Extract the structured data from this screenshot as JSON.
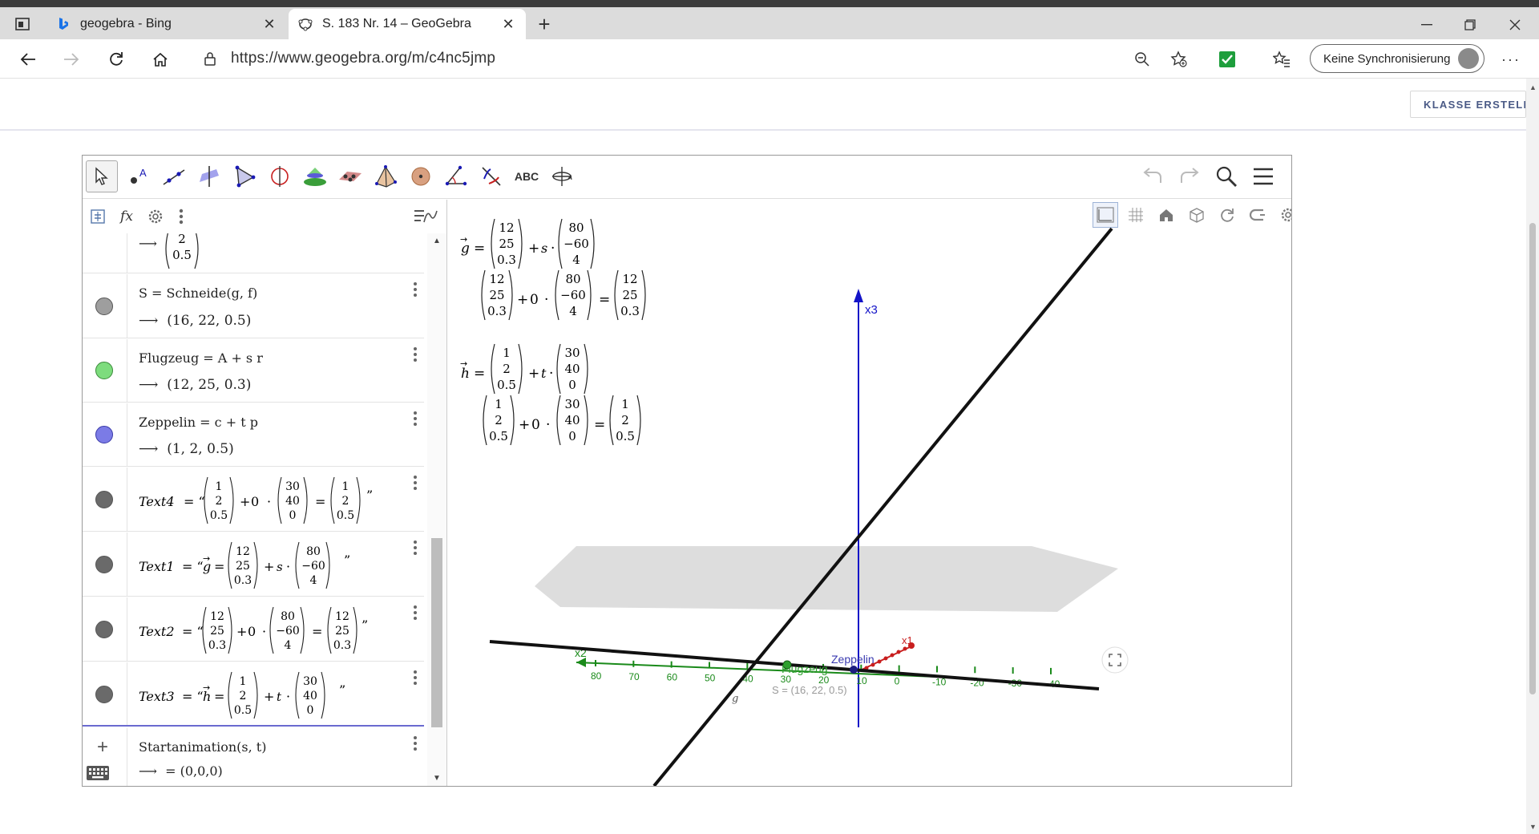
{
  "browser": {
    "tabs": [
      {
        "title": "geogebra - Bing",
        "active": false
      },
      {
        "title": "S. 183 Nr. 14 – GeoGebra",
        "active": true
      }
    ],
    "url": "https://www.geogebra.org/m/c4nc5jmp",
    "sync_label": "Keine Synchronisierung",
    "colors": {
      "accent_green": "#1e9e3c"
    }
  },
  "page": {
    "class_button": "KLASSE ERSTELLE"
  },
  "applet": {
    "toolbar": {
      "tools": [
        "move-tool",
        "point-tool",
        "line-tool",
        "perpendicular-tool",
        "polygon-tool",
        "circle-tool",
        "intersect-surfaces-tool",
        "plane-tool",
        "pyramid-tool",
        "sphere-tool",
        "angle-tool",
        "reflect-tool",
        "text-tool",
        "rotate-view-tool"
      ],
      "text_tool_label": "ABC"
    },
    "algebra": {
      "top_value": [
        "2",
        "0.5"
      ],
      "rows": [
        {
          "def_lhs": "S",
          "def_rhs": "Schneide(g, f)",
          "value": "(16, 22, 0.5)",
          "marble_color": "#9e9e9e"
        },
        {
          "def_lhs": "Flugzeug",
          "def_rhs": "A + s r",
          "value": "(12, 25, 0.3)",
          "marble_color": "#7ddc7d"
        },
        {
          "def_lhs": "Zeppelin",
          "def_rhs": "c + t p",
          "value": "(1, 2, 0.5)",
          "marble_color": "#7b7be6"
        },
        {
          "def_lhs": "Text4",
          "marble_color": "#6a6a6a"
        },
        {
          "def_lhs": "Text1",
          "marble_color": "#6a6a6a"
        },
        {
          "def_lhs": "Text2",
          "marble_color": "#6a6a6a"
        },
        {
          "def_lhs": "Text3",
          "marble_color": "#6a6a6a"
        }
      ],
      "input_row": {
        "def": "Startanimation(s, t)",
        "value": "= (0,0,0)"
      }
    },
    "view3d": {
      "eq_g": {
        "name": "g",
        "p": [
          "12",
          "25",
          "0.3"
        ],
        "param": "s",
        "d": [
          "80",
          "−60",
          "4"
        ]
      },
      "eq_h": {
        "name": "h",
        "p": [
          "1",
          "2",
          "0.5"
        ],
        "param": "t",
        "d": [
          "30",
          "40",
          "0"
        ]
      },
      "eval_g": {
        "factor": "0",
        "result": [
          "12",
          "25",
          "0.3"
        ]
      },
      "eval_h": {
        "factor": "0",
        "result": [
          "1",
          "2",
          "0.5"
        ]
      },
      "labels": {
        "x3": "x3",
        "x2": "x2",
        "x1": "x1",
        "zeppelin": "Zeppelin",
        "flugzeug": "Flugzeug",
        "s_label": "S = (16, 22, 0.5)",
        "g_label": "g"
      },
      "x2_ticks": [
        "80",
        "70",
        "60",
        "50",
        "40",
        "30",
        "20",
        "10",
        "0",
        "-10",
        "-20",
        "-30",
        "-40"
      ],
      "colors": {
        "axis_green": "#1a8a1a",
        "axis_blue": "#1414c8",
        "axis_red": "#c81e1e",
        "line": "#111111"
      }
    }
  }
}
